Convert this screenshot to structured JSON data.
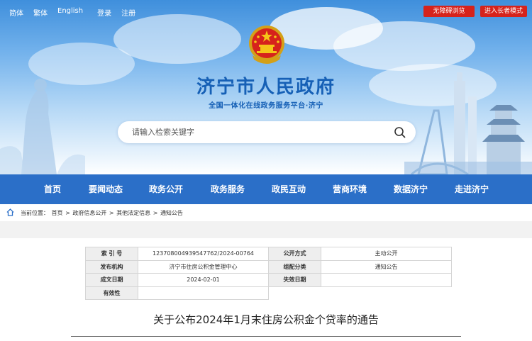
{
  "topbar": {
    "links": [
      "简体",
      "繁体",
      "English"
    ],
    "auth": [
      "登录",
      "注册"
    ],
    "btn_barrier_free": "无障碍浏览",
    "btn_elder_mode": "进入长者模式"
  },
  "site": {
    "title": "济宁市人民政府",
    "subtitle": "全国一体化在线政务服务平台·济宁"
  },
  "search": {
    "placeholder": "请输入检索关键字"
  },
  "nav": {
    "items": [
      "首页",
      "要闻动态",
      "政务公开",
      "政务服务",
      "政民互动",
      "营商环境",
      "数据济宁",
      "走进济宁"
    ]
  },
  "breadcrumb": {
    "prefix": "当前位置：",
    "items": [
      "首页",
      "政府信息公开",
      "其他法定信息",
      "通知公告"
    ],
    "separator": ">"
  },
  "info": {
    "rows": [
      {
        "k1": "索 引 号",
        "v1": "12370800493954776​2/2024-00764",
        "k2": "公开方式",
        "v2": "主动公开"
      },
      {
        "k1": "发布机构",
        "v1": "济宁市住房公积金管理中心",
        "k2": "组配分类",
        "v2": "通知公告"
      },
      {
        "k1": "成文日期",
        "v1": "2024-02-01",
        "k2": "失效日期",
        "v2": ""
      },
      {
        "k1": "有效性",
        "v1": "",
        "k2": "",
        "v2": ""
      }
    ]
  },
  "article": {
    "title": "关于公布2024年1月末住房公积金个贷率的通告"
  },
  "colors": {
    "nav_bg": "#2b6fc8",
    "title_blue": "#1660b6",
    "btn_red": "#d6231c"
  }
}
